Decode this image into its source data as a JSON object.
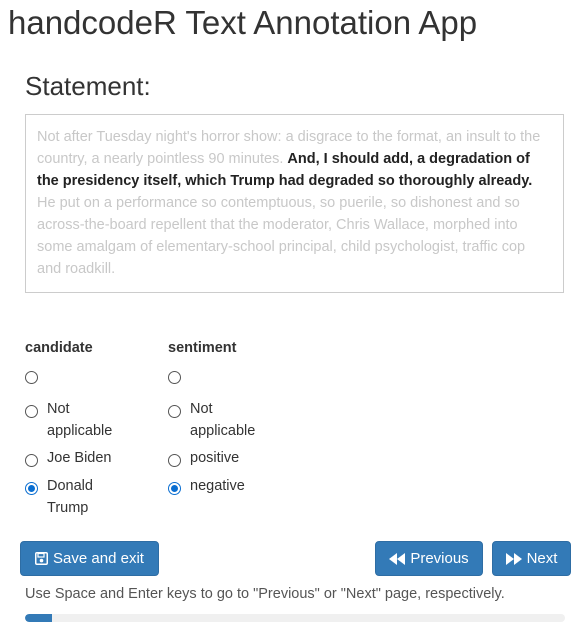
{
  "app": {
    "title": "handcodeR Text Annotation App"
  },
  "statement": {
    "heading": "Statement:",
    "context_before": "Not after Tuesday night's horror show: a disgrace to the format, an insult to the country, a nearly pointless 90 minutes. ",
    "highlight": "And, I should add, a degradation of the presidency itself, which Trump had degraded so thoroughly already.",
    "context_after": " He put on a performance so contemptuous, so puerile, so dishonest and so across-the-board repellent that the moderator, Chris Wallace, morphed into some amalgam of elementary-school principal, child psychologist, traffic cop and roadkill."
  },
  "candidate": {
    "label": "candidate",
    "options": [
      {
        "label": "",
        "checked": false
      },
      {
        "label": "Not applicable",
        "checked": false
      },
      {
        "label": "Joe Biden",
        "checked": false
      },
      {
        "label": "Donald Trump",
        "checked": true
      }
    ]
  },
  "sentiment": {
    "label": "sentiment",
    "options": [
      {
        "label": "",
        "checked": false
      },
      {
        "label": "Not applicable",
        "checked": false
      },
      {
        "label": "positive",
        "checked": false
      },
      {
        "label": "negative",
        "checked": true
      }
    ]
  },
  "buttons": {
    "save_label": "Save and exit",
    "previous_label": "Previous",
    "next_label": "Next"
  },
  "hint": "Use Space and Enter keys to go to \"Previous\" or \"Next\" page, respectively.",
  "progress": {
    "fraction": 0.05
  },
  "colors": {
    "primary": "#337ab7",
    "radio_checked": "#0a6ed1"
  }
}
